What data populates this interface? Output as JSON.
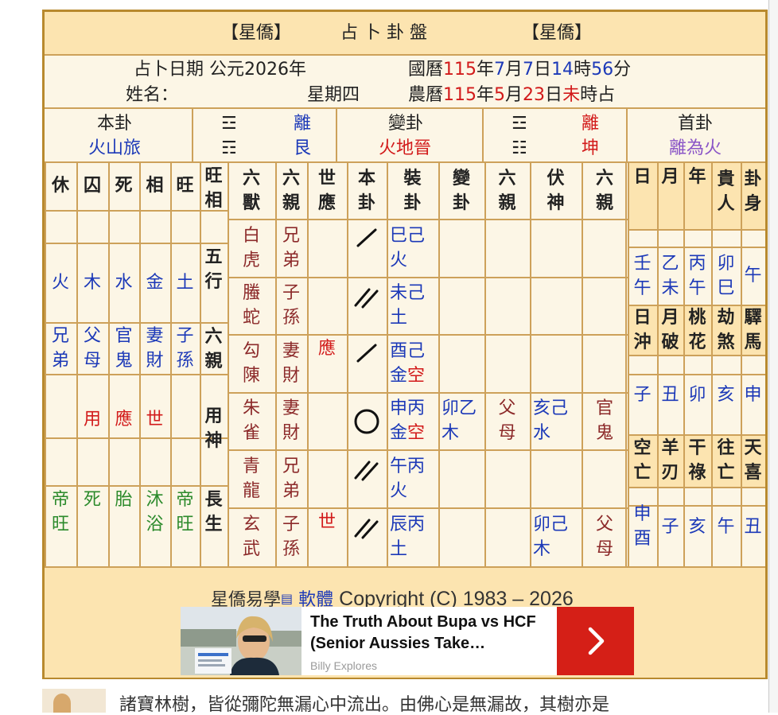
{
  "header": {
    "tag_left": "【星僑】",
    "title": "占 卜 卦 盤",
    "tag_right": "【星僑】"
  },
  "info": {
    "date_label": "占卜日期",
    "date_year": "公元2026年",
    "name_label": "姓名：",
    "weekday": "星期四",
    "gregorian": {
      "prefix": "國曆",
      "year": "115",
      "y": "年",
      "month": "7",
      "m": "月",
      "day": "7",
      "d": "日",
      "hour": "14",
      "h": "時",
      "min": "56",
      "mi": "分"
    },
    "lunar": {
      "prefix": "農曆",
      "year": "115",
      "y": "年",
      "month": "5",
      "m": "月",
      "day": "23",
      "d": "日",
      "hour": "未",
      "h": "時占"
    }
  },
  "gua": {
    "ben_label": "本卦",
    "ben_name": "火山旅",
    "ben_upper_symbol": "☲",
    "ben_upper_name": "離",
    "ben_lower_symbol": "☶",
    "ben_lower_name": "艮",
    "bian_label": "變卦",
    "bian_name": "火地晉",
    "bian_upper_symbol": "☲",
    "bian_upper_name": "離",
    "bian_lower_symbol": "☷",
    "bian_lower_name": "坤",
    "shou_label": "首卦",
    "shou_name": "離為火"
  },
  "seasons": {
    "headers": [
      "休",
      "囚",
      "死",
      "相",
      "旺"
    ],
    "wuxing": [
      "火",
      "木",
      "水",
      "金",
      "土"
    ],
    "liuqin": [
      [
        "兄",
        "弟"
      ],
      [
        "父",
        "母"
      ],
      [
        "官",
        "鬼"
      ],
      [
        "妻",
        "財"
      ],
      [
        "子",
        "孫"
      ]
    ],
    "yongshen": [
      "",
      "用",
      "應",
      "世",
      ""
    ],
    "changsheng": [
      [
        "帝",
        "旺"
      ],
      [
        "死",
        ""
      ],
      [
        "胎",
        ""
      ],
      [
        "沐",
        "浴"
      ],
      [
        "帝",
        "旺"
      ]
    ]
  },
  "row_labels": [
    [
      "旺",
      "相"
    ],
    [
      "五",
      "行"
    ],
    [
      "六",
      "親"
    ],
    [
      "用",
      "神"
    ],
    [
      "長",
      "生"
    ]
  ],
  "main_headers": [
    [
      "六",
      "獸"
    ],
    [
      "六",
      "親"
    ],
    [
      "世",
      "應"
    ],
    [
      "本",
      "卦"
    ],
    [
      "裝",
      "卦"
    ],
    [
      "變",
      "卦"
    ],
    [
      "六",
      "親"
    ],
    [
      "伏",
      "神"
    ],
    [
      "六",
      "親"
    ]
  ],
  "yao_rows": [
    {
      "beast": [
        "白",
        "虎"
      ],
      "kin": [
        "兄",
        "弟"
      ],
      "sy": "",
      "line": "yang",
      "zhuang": [
        [
          "巳",
          "己"
        ],
        [
          "火"
        ]
      ],
      "bian": [],
      "bkin": [],
      "fu": [],
      "fkin": []
    },
    {
      "beast": [
        "螣",
        "蛇"
      ],
      "kin": [
        "子",
        "孫"
      ],
      "sy": "",
      "line": "yin",
      "zhuang": [
        [
          "未",
          "己"
        ],
        [
          "土"
        ]
      ],
      "bian": [],
      "bkin": [],
      "fu": [],
      "fkin": []
    },
    {
      "beast": [
        "勾",
        "陳"
      ],
      "kin": [
        "妻",
        "財"
      ],
      "sy": "應",
      "line": "yang",
      "zhuang": [
        [
          "酉",
          "己"
        ],
        [
          "金",
          "空"
        ]
      ],
      "bian": [],
      "bkin": [],
      "fu": [],
      "fkin": []
    },
    {
      "beast": [
        "朱",
        "雀"
      ],
      "kin": [
        "妻",
        "財"
      ],
      "sy": "",
      "line": "moving",
      "zhuang": [
        [
          "申",
          "丙"
        ],
        [
          "金",
          "空"
        ]
      ],
      "bian": [
        [
          "卯",
          "乙"
        ],
        [
          "木"
        ]
      ],
      "bkin": [
        "父",
        "母"
      ],
      "fu": [
        [
          "亥",
          "己"
        ],
        [
          "水"
        ]
      ],
      "fkin": [
        "官",
        "鬼"
      ]
    },
    {
      "beast": [
        "青",
        "龍"
      ],
      "kin": [
        "兄",
        "弟"
      ],
      "sy": "",
      "line": "yin",
      "zhuang": [
        [
          "午",
          "丙"
        ],
        [
          "火"
        ]
      ],
      "bian": [],
      "bkin": [],
      "fu": [],
      "fkin": []
    },
    {
      "beast": [
        "玄",
        "武"
      ],
      "kin": [
        "子",
        "孫"
      ],
      "sy": "世",
      "line": "yin",
      "zhuang": [
        [
          "辰",
          "丙"
        ],
        [
          "土"
        ]
      ],
      "bian": [],
      "bkin": [],
      "fu": [
        [
          "卯",
          "己"
        ],
        [
          "木"
        ]
      ],
      "fkin": [
        "父",
        "母"
      ]
    }
  ],
  "right_panel": {
    "headers": [
      [
        "日"
      ],
      [
        "月"
      ],
      [
        "年"
      ],
      [
        "貴",
        "人"
      ],
      [
        "卦",
        "身"
      ]
    ],
    "values1": [
      [
        "壬",
        "午"
      ],
      [
        "乙",
        "未"
      ],
      [
        "丙",
        "午"
      ],
      [
        "卯",
        "巳"
      ],
      [
        "午"
      ]
    ],
    "headers2": [
      [
        "日",
        "沖"
      ],
      [
        "月",
        "破"
      ],
      [
        "桃",
        "花"
      ],
      [
        "劫",
        "煞"
      ],
      [
        "驛",
        "馬"
      ]
    ],
    "values2": [
      "子",
      "丑",
      "卯",
      "亥",
      "申"
    ],
    "headers3": [
      [
        "空",
        "亡"
      ],
      [
        "羊",
        "刃"
      ],
      [
        "干",
        "祿"
      ],
      [
        "往",
        "亡"
      ],
      [
        "天",
        "喜"
      ]
    ],
    "values3": [
      [
        "申",
        "酉"
      ],
      [
        "子"
      ],
      [
        "亥"
      ],
      [
        "午"
      ],
      [
        "丑"
      ]
    ]
  },
  "footer": {
    "brand": "星僑易學",
    "link": "軟體",
    "copyright": "Copyright (C) 1983 – 2026"
  },
  "ad": {
    "title": "The Truth About Bupa vs HCF (Senior Aussies Take…",
    "source": "Billy Explores"
  },
  "bottom_text": "諸寶林樹，皆從彌陀無漏心中流出。由佛心是無漏故，其樹亦是"
}
